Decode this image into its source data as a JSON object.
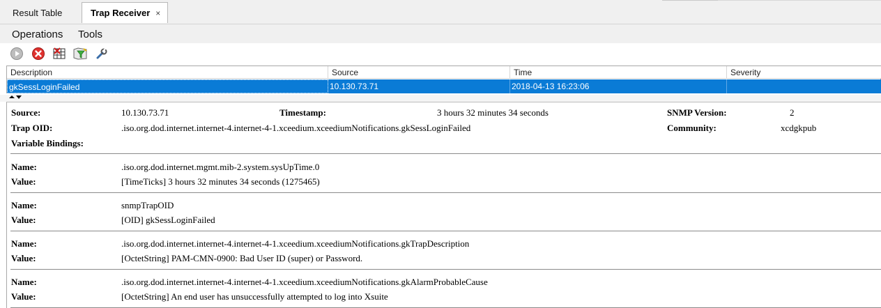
{
  "tabs": {
    "result_table": "Result Table",
    "trap_receiver": "Trap Receiver",
    "close_glyph": "×"
  },
  "menu": {
    "operations": "Operations",
    "tools": "Tools"
  },
  "toolbar": {
    "icons": [
      "play-icon",
      "stop-icon",
      "clear-table-icon",
      "filter-icon",
      "settings-wrench-icon"
    ]
  },
  "table": {
    "columns": [
      "Description",
      "Source",
      "Time",
      "Severity"
    ],
    "rows": [
      {
        "description": "gkSessLoginFailed",
        "source": "10.130.73.71",
        "time": "2018-04-13 16:23:06",
        "severity": ""
      }
    ]
  },
  "details": {
    "source_label": "Source:",
    "source_value": "10.130.73.71",
    "timestamp_label": "Timestamp:",
    "timestamp_value": "3 hours 32 minutes 34 seconds",
    "snmp_version_label": "SNMP Version:",
    "snmp_version_value": "2",
    "trap_oid_label": "Trap OID:",
    "trap_oid_value": ".iso.org.dod.internet.internet-4.internet-4-1.xceedium.xceediumNotifications.gkSessLoginFailed",
    "community_label": "Community:",
    "community_value": "xcdgkpub",
    "variable_bindings_label": "Variable Bindings:",
    "name_label": "Name:",
    "value_label": "Value:",
    "bindings": [
      {
        "name": ".iso.org.dod.internet.mgmt.mib-2.system.sysUpTime.0",
        "value": "[TimeTicks] 3 hours 32 minutes 34 seconds (1275465)"
      },
      {
        "name": "snmpTrapOID",
        "value": "[OID] gkSessLoginFailed"
      },
      {
        "name": ".iso.org.dod.internet.internet-4.internet-4-1.xceedium.xceediumNotifications.gkTrapDescription",
        "value": "[OctetString] PAM-CMN-0900: Bad User ID (super) or Password."
      },
      {
        "name": ".iso.org.dod.internet.internet-4.internet-4-1.xceedium.xceediumNotifications.gkAlarmProbableCause",
        "value": "[OctetString] An end user has unsuccessfully attempted to log into Xsuite"
      }
    ]
  },
  "colors": {
    "selection": "#0a7bd6",
    "chrome": "#f0f0f0"
  }
}
